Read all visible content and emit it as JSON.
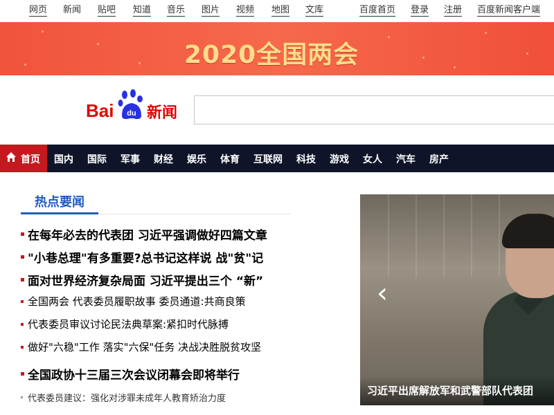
{
  "topnav": {
    "links": [
      "网页",
      "新闻",
      "贴吧",
      "知道",
      "音乐",
      "图片",
      "视频",
      "地图",
      "文库"
    ],
    "right": [
      "百度首页",
      "登录",
      "注册",
      "百度新闻客户端"
    ]
  },
  "banner": {
    "title": "2020全国两会"
  },
  "logo": {
    "bai": "Bai",
    "du": "du",
    "xinwen": "新闻"
  },
  "search": {
    "value": ""
  },
  "rednav": {
    "home": "首页",
    "items": [
      "国内",
      "国际",
      "军事",
      "财经",
      "娱乐",
      "体育",
      "互联网",
      "科技",
      "游戏",
      "女人",
      "汽车",
      "房产"
    ]
  },
  "hotnews": {
    "title": "热点要闻",
    "items": [
      "在每年必去的代表团 习近平强调做好四篇文章",
      "\"小巷总理\"有多重要?总书记这样说 战\"贫\"记",
      "面对世界经济复杂局面 习近平提出三个 “新”",
      "全国两会 代表委员履职故事 委员通道:共商良策",
      "代表委员审议讨论民法典草案:紧扣时代脉搏",
      "做好\"六稳\"工作 落实\"六保\"任务 决战决胜脱贫攻坚",
      "全国政协十三届三次会议闭幕会即将举行",
      "代表委员建议：强化对涉罪未成年人教育矫治力度"
    ]
  },
  "slider": {
    "caption": "习近平出席解放军和武警部队代表团",
    "prev_arrow": "‹"
  },
  "colors": {
    "brand_red": "#c4191e",
    "nav_dark": "#0f1429",
    "link_blue": "#1f5bbc"
  }
}
